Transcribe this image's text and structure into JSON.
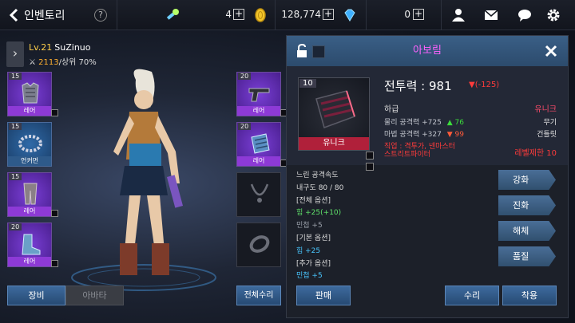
{
  "header": {
    "title": "인벤토리",
    "help": "?",
    "currency1": "4",
    "currency2": "128,774",
    "currency3": "0",
    "plus": "+"
  },
  "character": {
    "level": "Lv.21",
    "name": "SuZinuo",
    "power": "2113",
    "rank": "/상위 70%"
  },
  "left_slots": [
    {
      "level": "15",
      "grade": "레어"
    },
    {
      "level": "15",
      "grade": "언커먼"
    },
    {
      "level": "15",
      "grade": "레어"
    },
    {
      "level": "20",
      "grade": "레어"
    }
  ],
  "right_slots": [
    {
      "level": "20",
      "grade": "레어"
    },
    {
      "level": "20",
      "grade": "레어"
    }
  ],
  "bottom_left": {
    "equip_tab": "장비",
    "avatar_tab": "아바타",
    "repair_all": "전체수리"
  },
  "item": {
    "name": "아보림",
    "level": "10",
    "grade": "유니크",
    "power_label": "전투력 : 981",
    "power_diff": "(-125)",
    "tier": "하급",
    "rarity": "유니크",
    "stat1_label": "물리 공격력 +725",
    "stat1_delta": "76",
    "stat1_type": "무기",
    "stat2_label": "마법 공격력 +327",
    "stat2_delta": "99",
    "stat2_type": "건틀릿",
    "job_line1": "직업 : 격투가, 넨마스터",
    "job_line2": "스트리트파이터",
    "level_req": "레벨제한 10"
  },
  "stats": [
    {
      "text": "느린 공격속도",
      "style": "box"
    },
    {
      "text": "내구도 80 / 80",
      "style": "box"
    },
    {
      "text": "[전체 옵션]",
      "style": "box"
    },
    {
      "text": "힘 +25",
      "extra": "(+10)",
      "style": "green"
    },
    {
      "text": "민첩 +5",
      "style": "gray"
    },
    {
      "text": "[기본 옵션]",
      "style": "box"
    },
    {
      "text": "힘 +25",
      "style": "cyan"
    },
    {
      "text": "[추가 옵션]",
      "style": "box"
    },
    {
      "text": "민첩 +5",
      "style": "cyan"
    }
  ],
  "actions": {
    "enhance": "강화",
    "evolve": "진화",
    "disassemble": "해체",
    "quality": "품질",
    "sell": "판매",
    "repair": "수리",
    "equip": "착용"
  },
  "colors": {
    "unique": "#ff4b6b",
    "title": "#ff62ff",
    "positive": "#3cdc3c",
    "negative": "#ff3b3b"
  }
}
